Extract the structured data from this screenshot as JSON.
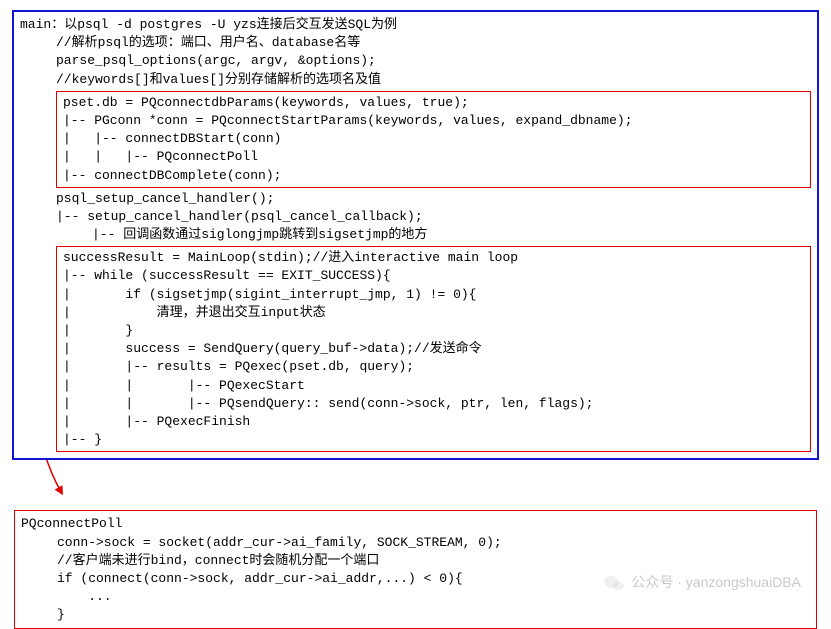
{
  "main": {
    "l1": "main：以psql -d postgres -U yzs连接后交互发送SQL为例",
    "l2": "//解析psql的选项：端口、用户名、database名等",
    "l3": "parse_psql_options(argc, argv, &options);",
    "l4": "//keywords[]和values[]分别存储解析的选项名及值",
    "box1": {
      "l1": "pset.db = PQconnectdbParams(keywords, values, true);",
      "l2": "|-- PGconn *conn = PQconnectStartParams(keywords, values, expand_dbname);",
      "l3": "|   |-- connectDBStart(conn)",
      "l4": "|   |   |-- PQconnectPoll",
      "l5": "|-- connectDBComplete(conn);"
    },
    "postbox1a": "psql_setup_cancel_handler();",
    "postbox1b": "|-- setup_cancel_handler(psql_cancel_callback);",
    "postbox1c": "|-- 回调函数通过siglongjmp跳转到sigsetjmp的地方",
    "box2": {
      "l1": "successResult = MainLoop(stdin);//进入interactive main loop",
      "l2": "|-- while (successResult == EXIT_SUCCESS){",
      "l3": "|       if (sigsetjmp(sigint_interrupt_jmp, 1) != 0){",
      "l4": "|           清理，并退出交互input状态",
      "l5": "|       }",
      "l6": "|       success = SendQuery(query_buf->data);//发送命令",
      "l7": "|       |-- results = PQexec(pset.db, query);",
      "l8": "|       |       |-- PQexecStart",
      "l9": "|       |       |-- PQsendQuery:: send(conn->sock, ptr, len, flags);",
      "l10": "|       |-- PQexecFinish",
      "l11": "|-- }"
    }
  },
  "bottom": {
    "l1": "PQconnectPoll",
    "l2": "conn->sock = socket(addr_cur->ai_family, SOCK_STREAM, 0);",
    "l3": "//客户端未进行bind，connect时会随机分配一个端口",
    "l4": "if (connect(conn->sock, addr_cur->ai_addr,...) < 0){",
    "l5": "    ...",
    "l6": "}"
  },
  "watermark": "公众号 · yanzongshuaiDBA"
}
